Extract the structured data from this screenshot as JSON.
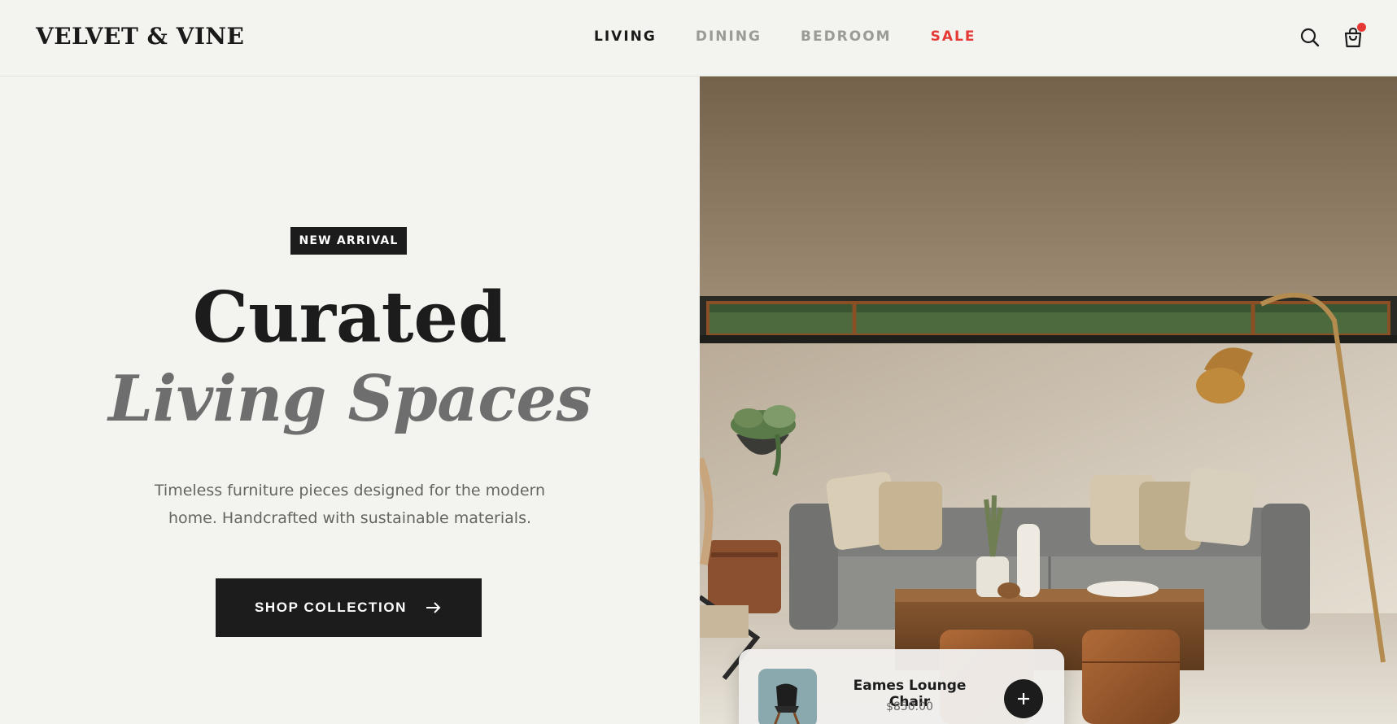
{
  "brand": {
    "name": "VELVET & VINE"
  },
  "nav": {
    "items": [
      {
        "label": "LIVING",
        "state": "active"
      },
      {
        "label": "DINING",
        "state": "muted"
      },
      {
        "label": "BEDROOM",
        "state": "muted"
      },
      {
        "label": "SALE",
        "state": "sale"
      }
    ]
  },
  "header_icons": {
    "search": "search-icon",
    "cart": "shopping-bag-icon",
    "cart_badge": "notification-dot"
  },
  "hero": {
    "badge": "NEW ARRIVAL",
    "title_line1": "Curated",
    "title_line2": "Living Spaces",
    "subtitle_line1": "Timeless furniture pieces designed for the modern",
    "subtitle_line2": "home. Handcrafted with sustainable materials.",
    "cta_label": "SHOP COLLECTION",
    "cta_icon": "arrow-right-icon"
  },
  "featured_product": {
    "name": "Eames Lounge Chair",
    "price": "$850.00",
    "add_icon": "plus-icon"
  },
  "colors": {
    "background": "#f3f3ef",
    "text": "#1c1c1c",
    "muted_nav": "#9a9a96",
    "sale": "#e53935",
    "accent_dark": "#1c1c1c"
  }
}
